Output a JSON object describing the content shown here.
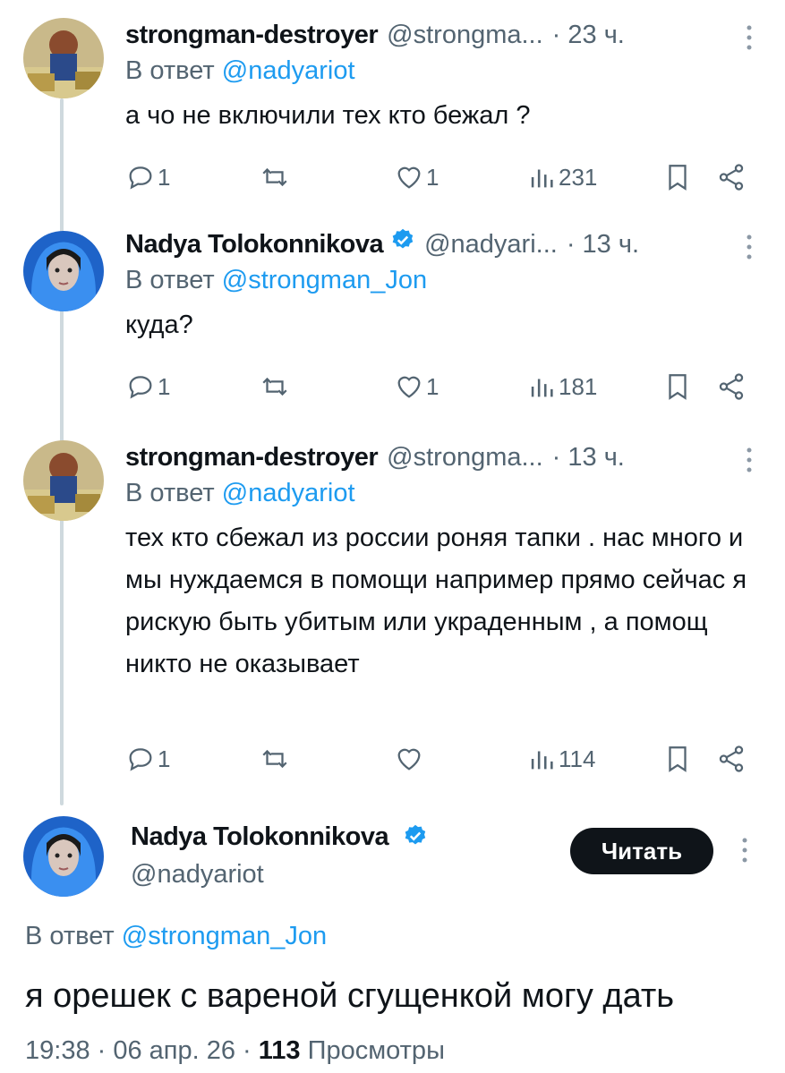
{
  "tweets": [
    {
      "name": "strongman-destroyer",
      "handle": "@strongma...",
      "time": "· 23 ч.",
      "reply_label": "В ответ",
      "reply_to": "@nadyariot",
      "text": "а чо не включили тех кто бежал ?",
      "replies": "1",
      "retweets": "",
      "likes": "1",
      "views": "231",
      "verified": false
    },
    {
      "name": "Nadya Tolokonnikova",
      "handle": "@nadyari...",
      "time": "· 13 ч.",
      "reply_label": "В ответ",
      "reply_to": "@strongman_Jon",
      "text": "куда?",
      "replies": "1",
      "retweets": "",
      "likes": "1",
      "views": "181",
      "verified": true
    },
    {
      "name": "strongman-destroyer",
      "handle": "@strongma...",
      "time": "· 13 ч.",
      "reply_label": "В ответ",
      "reply_to": "@nadyariot",
      "text": "тех кто сбежал из россии роняя тапки . нас много и мы нуждаемся в помощи например прямо сейчас я рискую быть убитым или украденным , а помощ никто не оказывает",
      "replies": "1",
      "retweets": "",
      "likes": "",
      "views": "114",
      "verified": false
    }
  ],
  "main_tweet": {
    "name": "Nadya Tolokonnikova",
    "handle": "@nadyariot",
    "follow_label": "Читать",
    "reply_label": "В ответ",
    "reply_to": "@strongman_Jon",
    "text": "я орешек с вареной сгущенкой могу дать",
    "timestamp": "19:38 · 06 апр. 26 ·",
    "views_count": "113",
    "views_label": "Просмотры"
  },
  "colors": {
    "accent": "#1d9bf0",
    "text": "#0f1419",
    "secondary": "#536471",
    "thread_line": "#cfd9de"
  }
}
